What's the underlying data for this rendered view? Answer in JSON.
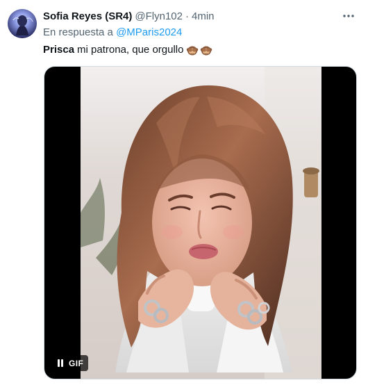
{
  "tweet": {
    "author": {
      "display_name": "Sofia Reyes (SR4)",
      "handle": "@Flyn102",
      "separator": "·",
      "time": "4min",
      "avatar": "avatar"
    },
    "reply": {
      "prefix": "En respuesta a",
      "handle": "@MParis2024"
    },
    "text": {
      "mention": "Prisca",
      "body": "mi patrona, que orgullo"
    },
    "emoji": [
      "see-no-evil-monkey-icon",
      "see-no-evil-monkey-icon"
    ],
    "media": {
      "type": "gif",
      "control_label": "GIF",
      "pause_icon": "pause-icon"
    },
    "more_icon": "more-horizontal-icon",
    "colors": {
      "text": "#0f1419",
      "secondary": "#536471",
      "link": "#1d9bf0",
      "border": "#cfd9de"
    }
  }
}
